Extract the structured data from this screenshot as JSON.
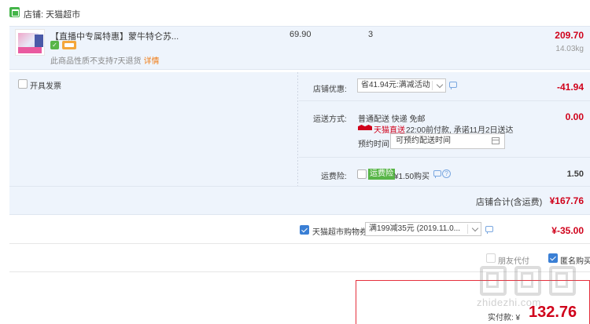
{
  "store": {
    "name": "店铺: 天猫超市",
    "icon": "store-icon"
  },
  "product": {
    "title": "【直播中专属特惠】蒙牛特仑苏...",
    "return_note": "此商品性质不支持7天退货",
    "detail_link": "详情",
    "unit_price": "69.90",
    "quantity": "3",
    "subtotal": "209.70",
    "weight": "14.03kg"
  },
  "invoice": {
    "label": "开具发票",
    "checked": false
  },
  "store_discount": {
    "label": "店铺优惠:",
    "value": "省41.94元:满减活动",
    "amount": "-41.94"
  },
  "shipping": {
    "label": "运送方式:",
    "method": "普通配送 快递 免邮",
    "tmall_direct": "天猫直送",
    "promise": "22:00前付款, 承诺11月2日送达",
    "reserve_label": "预约时间",
    "reserve_value": "可预约配送时间",
    "amount": "0.00"
  },
  "shipping_insurance": {
    "label": "运费险:",
    "tag": "运费险",
    "price": "¥1.50购买",
    "amount": "1.50",
    "checked": false
  },
  "store_total": {
    "label": "店铺合计(含运费)",
    "amount": "¥167.76"
  },
  "coupon": {
    "label": "天猫超市购物券",
    "value": "满199减35元 (2019.11.0...",
    "amount": "¥-35.00",
    "checked": true
  },
  "options": {
    "friend_pay": "朋友代付",
    "anonymous": "匿名购买",
    "friend_checked": false,
    "anonymous_checked": true
  },
  "final": {
    "label": "实付款: ¥",
    "amount": "132.76"
  },
  "watermark": {
    "text": "zhidezhi.com"
  },
  "colors": {
    "accent": "#d0021b",
    "panel": "#eef4fc",
    "check": "#3a7fd5",
    "green": "#58b548"
  }
}
